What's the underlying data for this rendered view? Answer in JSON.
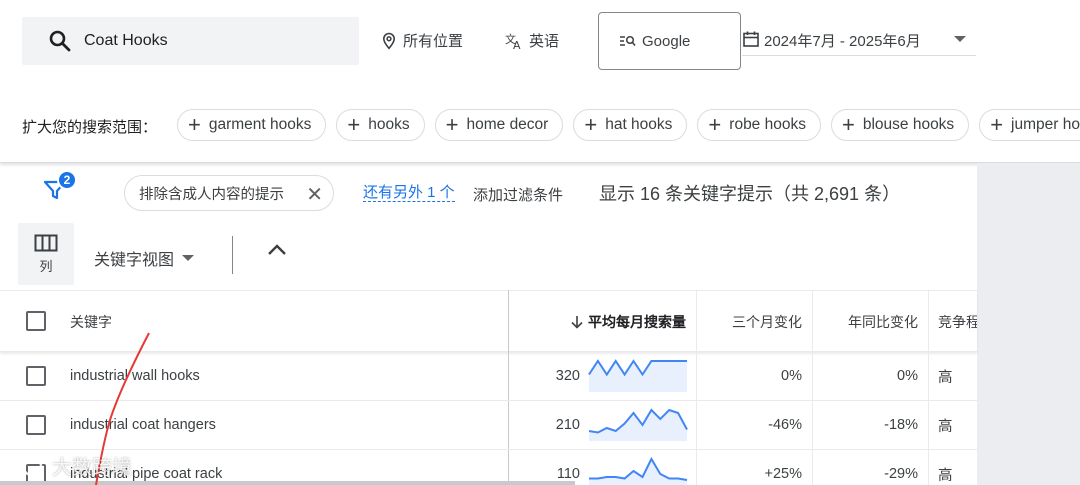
{
  "search": {
    "query": "Coat Hooks"
  },
  "filters": {
    "location": "所有位置",
    "language": "英语",
    "engine": "Google",
    "date_range": "2024年7月 - 2025年6月"
  },
  "expand": {
    "label": "扩大您的搜索范围：",
    "chips": [
      "garment hooks",
      "hooks",
      "home decor",
      "hat hooks",
      "robe hooks",
      "blouse hooks",
      "jumper hooks"
    ]
  },
  "filter_bar": {
    "badge_count": "2",
    "active_filter": "排除含成人内容的提示",
    "more_link": "还有另外 1 个",
    "add_filter": "添加过滤条件",
    "results": "显示 16 条关键字提示（共 2,691 条）"
  },
  "toolbar": {
    "columns_label": "列",
    "view_label": "关键字视图"
  },
  "table": {
    "headers": {
      "keyword": "关键字",
      "avg_searches": "平均每月搜索量",
      "three_month": "三个月变化",
      "yoy": "年同比变化",
      "competition": "竞争程度"
    },
    "rows": [
      {
        "keyword": "industrial wall hooks",
        "avg": "320",
        "three_month": "0%",
        "yoy": "0%",
        "competition": "高",
        "trend": [
          0.55,
          1.0,
          0.55,
          1.0,
          0.55,
          1.0,
          0.55,
          1.0,
          1.0,
          1.0,
          1.0,
          1.0
        ]
      },
      {
        "keyword": "industrial coat hangers",
        "avg": "210",
        "three_month": "-46%",
        "yoy": "-18%",
        "competition": "高",
        "trend": [
          0.3,
          0.25,
          0.4,
          0.3,
          0.55,
          0.9,
          0.5,
          1.0,
          0.7,
          1.0,
          0.9,
          0.35
        ]
      },
      {
        "keyword": "industrial pipe coat rack",
        "avg": "110",
        "three_month": "+25%",
        "yoy": "-29%",
        "competition": "高",
        "trend": [
          0.35,
          0.35,
          0.4,
          0.4,
          0.35,
          0.6,
          0.4,
          1.0,
          0.5,
          0.35,
          0.35,
          0.3
        ]
      }
    ]
  },
  "watermark": "大数跨境",
  "colors": {
    "accent": "#1a73e8",
    "spark_line": "#4285f4",
    "spark_fill": "#e8f0fe",
    "annotation": "#e53935"
  }
}
